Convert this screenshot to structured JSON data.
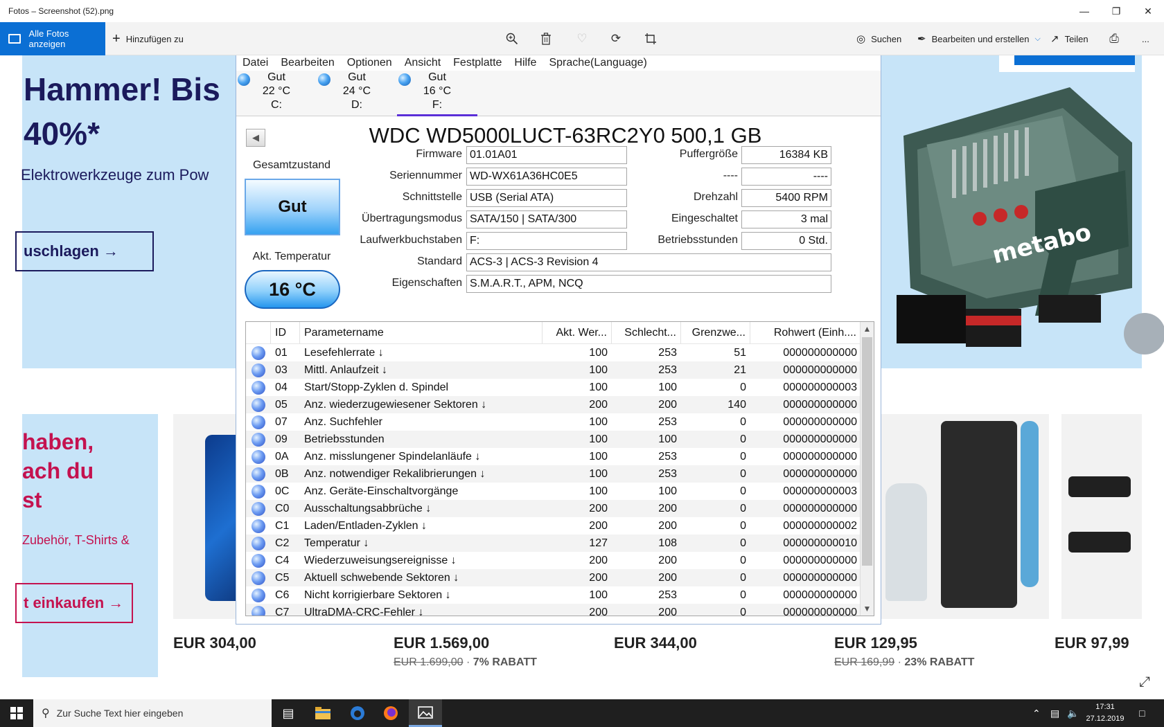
{
  "window": {
    "title": "Fotos – Screenshot (52).png"
  },
  "toolbar": {
    "all_photos": "Alle Fotos anzeigen",
    "add": "Hinzufügen zu",
    "search": "Suchen",
    "edit_create": "Bearbeiten und erstellen",
    "share": "Teilen",
    "more": "..."
  },
  "web": {
    "banner_line1": "Hammer! Bis",
    "banner_line2": "40%*",
    "banner_sub": "Elektrowerkzeuge zum Pow",
    "banner_cta": "uschlagen →",
    "drill_brand": "metabo",
    "card_line1": "haben,",
    "card_line2": "ach du",
    "card_line3": "st",
    "card_sub": "Zubehör, T-Shirts &",
    "card_cta": "t einkaufen →",
    "prices": [
      {
        "price": "EUR 304,00",
        "old": "",
        "discount": ""
      },
      {
        "price": "EUR 1.569,00",
        "old": "EUR 1.699,00",
        "discount": "7% RABATT"
      },
      {
        "price": "EUR 344,00",
        "old": "",
        "discount": ""
      },
      {
        "price": "EUR 129,95",
        "old": "EUR 169,99",
        "discount": "23% RABATT"
      },
      {
        "price": "EUR 97,99",
        "old": "",
        "discount": ""
      }
    ],
    "separator": "·"
  },
  "cdi": {
    "menu": [
      "Datei",
      "Bearbeiten",
      "Optionen",
      "Ansicht",
      "Festplatte",
      "Hilfe",
      "Sprache(Language)"
    ],
    "drives": [
      {
        "status": "Gut",
        "temp": "22 °C",
        "letter": "C:"
      },
      {
        "status": "Gut",
        "temp": "24 °C",
        "letter": "D:"
      },
      {
        "status": "Gut",
        "temp": "16 °C",
        "letter": "F:"
      }
    ],
    "model": "WDC WD5000LUCT-63RC2Y0 500,1 GB",
    "health_label": "Gesamtzustand",
    "health_value": "Gut",
    "temp_label": "Akt. Temperatur",
    "temp_value": "16 °C",
    "fields": {
      "firmware_label": "Firmware",
      "firmware": "01.01A01",
      "serial_label": "Seriennummer",
      "serial": "WD-WX61A36HC0E5",
      "interface_label": "Schnittstelle",
      "interface": "USB (Serial ATA)",
      "transfer_label": "Übertragungsmodus",
      "transfer": "SATA/150 | SATA/300",
      "letters_label": "Laufwerkbuchstaben",
      "letters": "F:",
      "standard_label": "Standard",
      "standard": "ACS-3 | ACS-3 Revision 4",
      "features_label": "Eigenschaften",
      "features": "S.M.A.R.T., APM, NCQ",
      "buffer_label": "Puffergröße",
      "buffer": "16384 KB",
      "blank_label": "----",
      "blank": "----",
      "rpm_label": "Drehzahl",
      "rpm": "5400 RPM",
      "power_on_count_label": "Eingeschaltet",
      "power_on_count": "3 mal",
      "power_on_hours_label": "Betriebsstunden",
      "power_on_hours": "0 Std."
    },
    "table_headers": [
      "",
      "ID",
      "Parametername",
      "Akt. Wer...",
      "Schlecht...",
      "Grenzwe...",
      "Rohwert (Einh...."
    ],
    "rows": [
      [
        "01",
        "Lesefehlerrate ↓",
        "100",
        "253",
        "51",
        "000000000000"
      ],
      [
        "03",
        "Mittl. Anlaufzeit ↓",
        "100",
        "253",
        "21",
        "000000000000"
      ],
      [
        "04",
        "Start/Stopp-Zyklen d. Spindel",
        "100",
        "100",
        "0",
        "000000000003"
      ],
      [
        "05",
        "Anz. wiederzugewiesener Sektoren ↓",
        "200",
        "200",
        "140",
        "000000000000"
      ],
      [
        "07",
        "Anz. Suchfehler",
        "100",
        "253",
        "0",
        "000000000000"
      ],
      [
        "09",
        "Betriebsstunden",
        "100",
        "100",
        "0",
        "000000000000"
      ],
      [
        "0A",
        "Anz. misslungener Spindelanläufe ↓",
        "100",
        "253",
        "0",
        "000000000000"
      ],
      [
        "0B",
        "Anz. notwendiger Rekalibrierungen ↓",
        "100",
        "253",
        "0",
        "000000000000"
      ],
      [
        "0C",
        "Anz. Geräte-Einschaltvorgänge",
        "100",
        "100",
        "0",
        "000000000003"
      ],
      [
        "C0",
        "Ausschaltungsabbrüche ↓",
        "200",
        "200",
        "0",
        "000000000000"
      ],
      [
        "C1",
        "Laden/Entladen-Zyklen ↓",
        "200",
        "200",
        "0",
        "000000000002"
      ],
      [
        "C2",
        "Temperatur ↓",
        "127",
        "108",
        "0",
        "000000000010"
      ],
      [
        "C4",
        "Wiederzuweisungsereignisse ↓",
        "200",
        "200",
        "0",
        "000000000000"
      ],
      [
        "C5",
        "Aktuell schwebende Sektoren ↓",
        "200",
        "200",
        "0",
        "000000000000"
      ],
      [
        "C6",
        "Nicht korrigierbare Sektoren ↓",
        "100",
        "253",
        "0",
        "000000000000"
      ],
      [
        "C7",
        "UltraDMA-CRC-Fehler ↓",
        "200",
        "200",
        "0",
        "000000000000"
      ]
    ]
  },
  "taskbar": {
    "search_placeholder": "Zur Suche Text hier eingeben",
    "time": "17:31",
    "date": "27.12.2019"
  }
}
